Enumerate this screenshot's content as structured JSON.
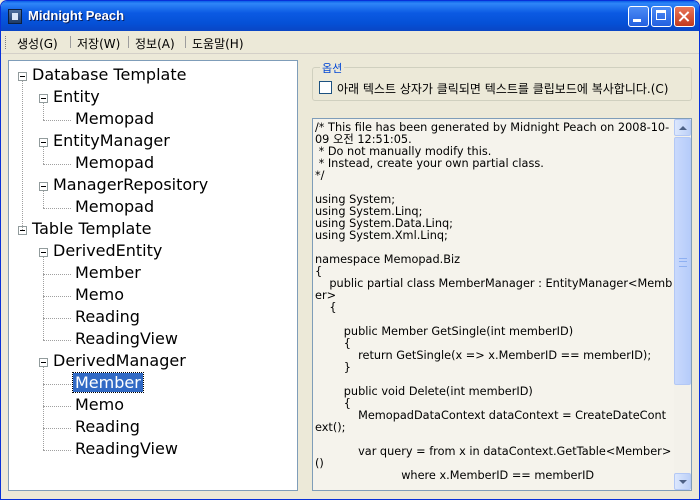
{
  "window": {
    "title": "Midnight Peach"
  },
  "menu": [
    {
      "label": "생성(G)"
    },
    {
      "label": "저장(W)"
    },
    {
      "label": "정보(A)"
    },
    {
      "label": "도움말(H)"
    }
  ],
  "tree": [
    {
      "label": "Database Template",
      "level": 0,
      "expanded": true
    },
    {
      "label": "Entity",
      "level": 1,
      "expanded": true
    },
    {
      "label": "Memopad",
      "level": 2
    },
    {
      "label": "EntityManager",
      "level": 1,
      "expanded": true
    },
    {
      "label": "Memopad",
      "level": 2
    },
    {
      "label": "ManagerRepository",
      "level": 1,
      "expanded": true
    },
    {
      "label": "Memopad",
      "level": 2
    },
    {
      "label": "Table Template",
      "level": 0,
      "expanded": true
    },
    {
      "label": "DerivedEntity",
      "level": 1,
      "expanded": true
    },
    {
      "label": "Member",
      "level": 2
    },
    {
      "label": "Memo",
      "level": 2
    },
    {
      "label": "Reading",
      "level": 2
    },
    {
      "label": "ReadingView",
      "level": 2
    },
    {
      "label": "DerivedManager",
      "level": 1,
      "expanded": true
    },
    {
      "label": "Member",
      "level": 2,
      "selected": true
    },
    {
      "label": "Memo",
      "level": 2
    },
    {
      "label": "Reading",
      "level": 2
    },
    {
      "label": "ReadingView",
      "level": 2
    }
  ],
  "options": {
    "group_title": "옵션",
    "copy_checkbox_label": "아래 텍스트 상자가 클릭되면 텍스트를 클립보드에 복사합니다.(C)",
    "copy_checked": false
  },
  "code": "/* This file has been generated by Midnight Peach on 2008-10-09 오전 12:51:05.\n * Do not manually modify this.\n * Instead, create your own partial class.\n*/\n\nusing System;\nusing System.Linq;\nusing System.Data.Linq;\nusing System.Xml.Linq;\n\nnamespace Memopad.Biz\n{\n    public partial class MemberManager : EntityManager<Member>\n    {\n\n        public Member GetSingle(int memberID)\n        {\n            return GetSingle(x => x.MemberID == memberID);\n        }\n\n        public void Delete(int memberID)\n        {\n            MemopadDataContext dataContext = CreateDateContext();\n\n            var query = from x in dataContext.GetTable<Member>()\n                        where x.MemberID == memberID"
}
